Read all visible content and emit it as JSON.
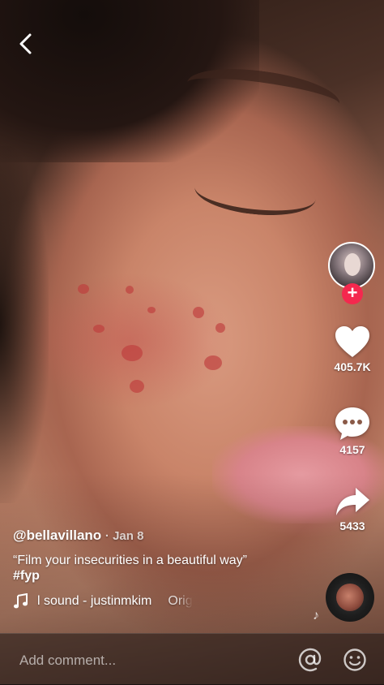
{
  "post": {
    "author": "@bellavillano",
    "separator": "·",
    "date": "Jan 8",
    "caption": "“Film your insecurities in a beautiful way”",
    "hashtag": "#fyp",
    "music_title": "l sound - justinmkim",
    "music_overflow": "Orig"
  },
  "actions": {
    "likes": "405.7K",
    "comments": "4157",
    "shares": "5433",
    "follow_symbol": "+"
  },
  "comment_bar": {
    "placeholder": "Add comment..."
  },
  "icons": {
    "back": "chevron-left-icon",
    "like": "heart-icon",
    "comment": "speech-bubble-icon",
    "share": "share-arrow-icon",
    "music": "music-note-icon",
    "mention": "at-sign-icon",
    "emoji": "smiley-icon"
  },
  "colors": {
    "accent": "#f4284e",
    "text": "#ffffff"
  }
}
